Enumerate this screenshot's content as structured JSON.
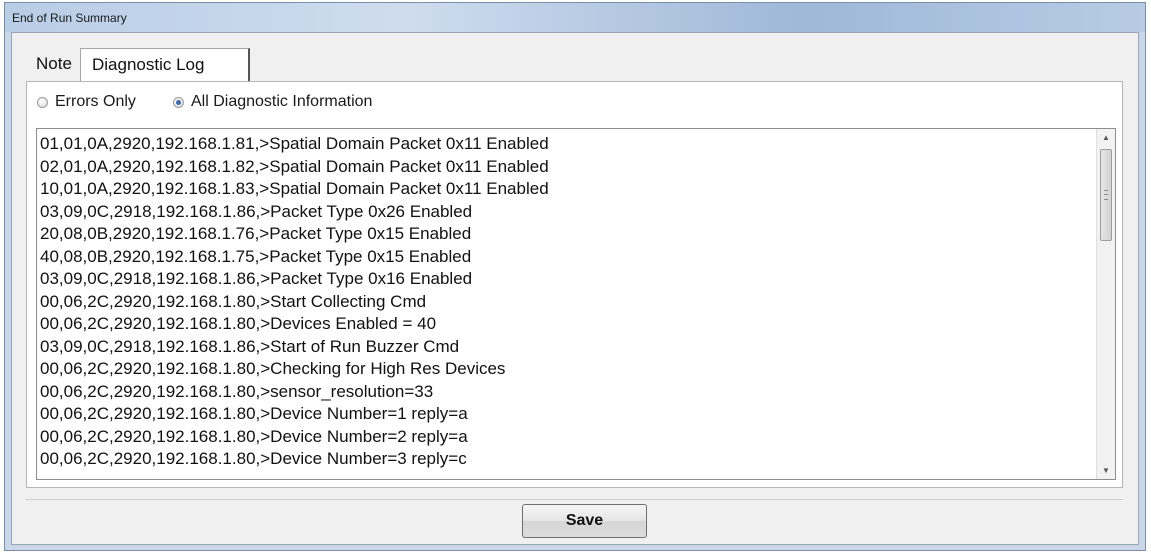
{
  "window": {
    "title": "End of Run Summary"
  },
  "tabs": [
    {
      "label": "Note"
    },
    {
      "label": "Diagnostic Log"
    }
  ],
  "filter": {
    "options": [
      {
        "label": "Errors Only",
        "selected": false
      },
      {
        "label": "All Diagnostic Information",
        "selected": true
      }
    ]
  },
  "log": {
    "lines": [
      "01,01,0A,2920,192.168.1.81,>Spatial Domain Packet 0x11 Enabled",
      "02,01,0A,2920,192.168.1.82,>Spatial Domain Packet 0x11 Enabled",
      "10,01,0A,2920,192.168.1.83,>Spatial Domain Packet 0x11 Enabled",
      "03,09,0C,2918,192.168.1.86,>Packet Type 0x26 Enabled",
      "20,08,0B,2920,192.168.1.76,>Packet Type 0x15 Enabled",
      "40,08,0B,2920,192.168.1.75,>Packet Type 0x15 Enabled",
      "03,09,0C,2918,192.168.1.86,>Packet Type 0x16 Enabled",
      "00,06,2C,2920,192.168.1.80,>Start Collecting Cmd",
      "00,06,2C,2920,192.168.1.80,>Devices Enabled = 40",
      "03,09,0C,2918,192.168.1.86,>Start of Run Buzzer Cmd",
      "00,06,2C,2920,192.168.1.80,>Checking for High Res Devices",
      "00,06,2C,2920,192.168.1.80,>sensor_resolution=33",
      "00,06,2C,2920,192.168.1.80,>Device Number=1 reply=a",
      "00,06,2C,2920,192.168.1.80,>Device Number=2 reply=a",
      "00,06,2C,2920,192.168.1.80,>Device Number=3 reply=c"
    ]
  },
  "footer": {
    "save_label": "Save"
  }
}
